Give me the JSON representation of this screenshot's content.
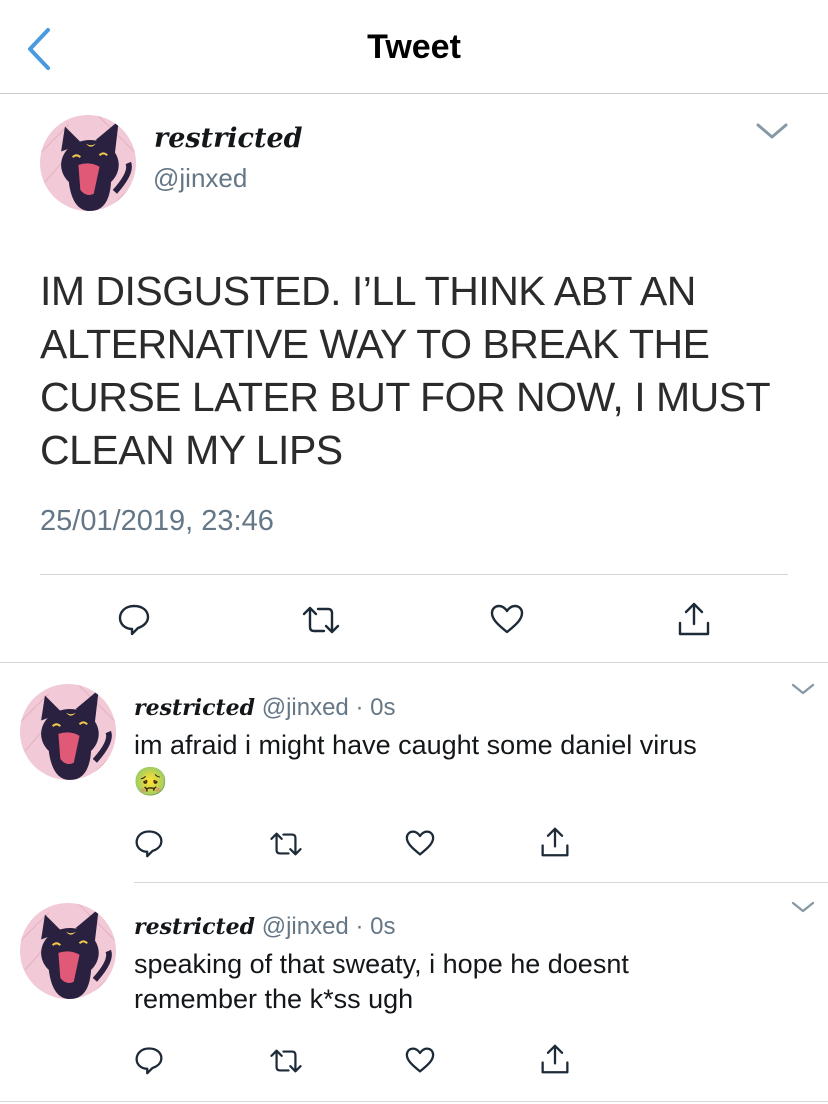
{
  "header": {
    "title": "Tweet"
  },
  "main_tweet": {
    "display_name": "restricted",
    "handle": "@jinxed",
    "text": "IM DISGUSTED. I’LL THINK ABT AN ALTERNATIVE WAY TO BREAK THE CURSE LATER BUT FOR NOW, I MUST CLEAN MY LIPS",
    "timestamp": "25/01/2019, 23:46"
  },
  "replies": [
    {
      "display_name": "restricted",
      "handle": "@jinxed",
      "dot": "·",
      "time": "0s",
      "text": "im afraid i might have caught some daniel virus",
      "emoji": "🤢"
    },
    {
      "display_name": "restricted",
      "handle": "@jinxed",
      "dot": "·",
      "time": "0s",
      "text": "speaking of that sweaty, i hope he doesnt remember the k*ss ugh"
    }
  ],
  "icons": [
    "back-chevron-icon",
    "chevron-down-icon",
    "reply-icon",
    "retweet-icon",
    "like-icon",
    "share-icon"
  ],
  "colors": {
    "accent": "#4a9ae0",
    "muted": "#657786",
    "icon": "#1d2a38",
    "avatar_bg": "#f2c6d3",
    "cat": "#2a2140"
  }
}
